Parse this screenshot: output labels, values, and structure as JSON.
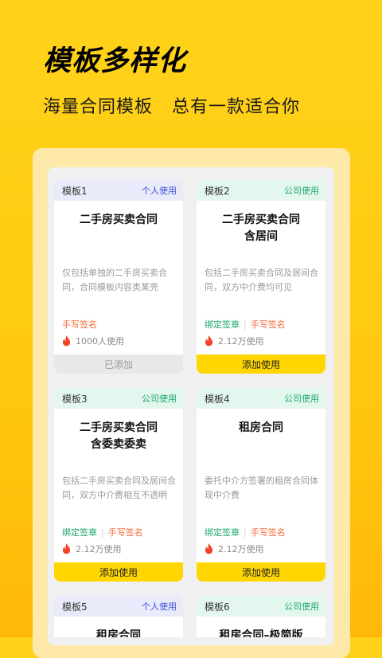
{
  "header": {
    "headline": "模板多样化",
    "subline": "海量合同模板   总有一款适合你"
  },
  "colors": {
    "background": "#FFC810",
    "accent_button": "#FFD600",
    "personal_tag": "#3D4FD9",
    "company_tag": "#18A86A",
    "handwrite_tag": "#F26B3A"
  },
  "templates": [
    {
      "label": "模板1",
      "type": "个人使用",
      "title_line1": "二手房买卖合同",
      "title_line2": "",
      "description": "仅包括单独的二手房买卖合同，合同模板内容类某壳",
      "tag_bind": "",
      "tag_hand": "手写签名",
      "usage": "1000人使用",
      "button": "已添加"
    },
    {
      "label": "模板2",
      "type": "公司使用",
      "title_line1": "二手房买卖合同",
      "title_line2": "含居间",
      "description": "包括二手房买卖合同及居间合同，双方中介费均可见",
      "tag_bind": "绑定签章",
      "tag_hand": "手写签名",
      "usage": "2.12万使用",
      "button": "添加使用"
    },
    {
      "label": "模板3",
      "type": "公司使用",
      "title_line1": "二手房买卖合同",
      "title_line2": "含委卖委卖",
      "description": "包括二手房买卖合同及居间合同，双方中介费相互不透明",
      "tag_bind": "绑定签章",
      "tag_hand": "手写签名",
      "usage": "2.12万使用",
      "button": "添加使用"
    },
    {
      "label": "模板4",
      "type": "公司使用",
      "title_line1": "租房合同",
      "title_line2": "",
      "description": "委托中介方签署的租房合同体现中介费",
      "tag_bind": "绑定签章",
      "tag_hand": "手写签名",
      "usage": "2.12万使用",
      "button": "添加使用"
    },
    {
      "label": "模板5",
      "type": "个人使用",
      "title_line1": "租房合同",
      "title_line2": ""
    },
    {
      "label": "模板6",
      "type": "公司使用",
      "title_line1": "租房合同–极简版",
      "title_line2": ""
    }
  ]
}
